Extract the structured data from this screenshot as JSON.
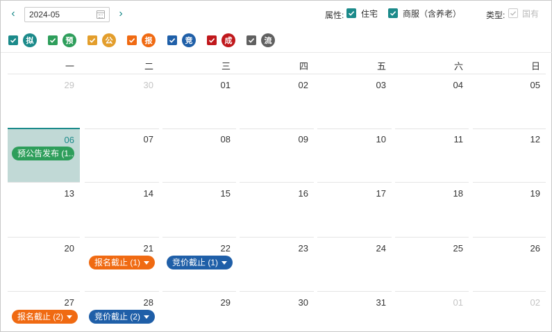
{
  "toolbar": {
    "prev_icon": "‹",
    "next_icon": "›",
    "month_value": "2024-05",
    "property_label": "属性:",
    "property_options": [
      {
        "label": "住宅",
        "checked": true
      },
      {
        "label": "商服（含养老）",
        "checked": true
      }
    ],
    "type_label": "类型:",
    "type_option": {
      "label": "国有",
      "checked": true,
      "disabled": true
    }
  },
  "colors": {
    "accent": "#1b8a8a",
    "green": "#2e9e5b",
    "gold": "#e39e2c",
    "orange": "#f06a12",
    "blue": "#1f5fa8",
    "red": "#c0181c",
    "gray": "#606060"
  },
  "legend": [
    {
      "char": "拟",
      "color": "#1b8a8a"
    },
    {
      "char": "预",
      "color": "#2e9e5b"
    },
    {
      "char": "公",
      "color": "#e39e2c"
    },
    {
      "char": "报",
      "color": "#f06a12"
    },
    {
      "char": "竞",
      "color": "#1f5fa8"
    },
    {
      "char": "成",
      "color": "#c0181c"
    },
    {
      "char": "流",
      "color": "#606060"
    }
  ],
  "weekdays": [
    "一",
    "二",
    "三",
    "四",
    "五",
    "六",
    "日"
  ],
  "weeks": [
    [
      {
        "day": "29",
        "muted": true
      },
      {
        "day": "30",
        "muted": true
      },
      {
        "day": "01"
      },
      {
        "day": "02"
      },
      {
        "day": "03"
      },
      {
        "day": "04"
      },
      {
        "day": "05"
      }
    ],
    [
      {
        "day": "06",
        "today": true
      },
      {
        "day": "07"
      },
      {
        "day": "08"
      },
      {
        "day": "09"
      },
      {
        "day": "10"
      },
      {
        "day": "11"
      },
      {
        "day": "12"
      }
    ],
    [
      {
        "day": "13"
      },
      {
        "day": "14"
      },
      {
        "day": "15"
      },
      {
        "day": "16"
      },
      {
        "day": "17"
      },
      {
        "day": "18"
      },
      {
        "day": "19"
      }
    ],
    [
      {
        "day": "20"
      },
      {
        "day": "21"
      },
      {
        "day": "22"
      },
      {
        "day": "23"
      },
      {
        "day": "24"
      },
      {
        "day": "25"
      },
      {
        "day": "26"
      }
    ],
    [
      {
        "day": "27"
      },
      {
        "day": "28"
      },
      {
        "day": "29"
      },
      {
        "day": "30"
      },
      {
        "day": "31"
      },
      {
        "day": "01",
        "muted": true
      },
      {
        "day": "02",
        "muted": true
      }
    ]
  ],
  "events": [
    {
      "week": 1,
      "col": 0,
      "label": "预公告发布 (1...",
      "color": "#2e9e5b",
      "caret": false
    },
    {
      "week": 3,
      "col": 1,
      "label": "报名截止 (1)",
      "color": "#f06a12",
      "caret": true
    },
    {
      "week": 3,
      "col": 2,
      "label": "竞价截止 (1)",
      "color": "#1f5fa8",
      "caret": true
    },
    {
      "week": 4,
      "col": 0,
      "label": "报名截止 (2)",
      "color": "#f06a12",
      "caret": true
    },
    {
      "week": 4,
      "col": 1,
      "label": "竞价截止 (2)",
      "color": "#1f5fa8",
      "caret": true
    }
  ]
}
